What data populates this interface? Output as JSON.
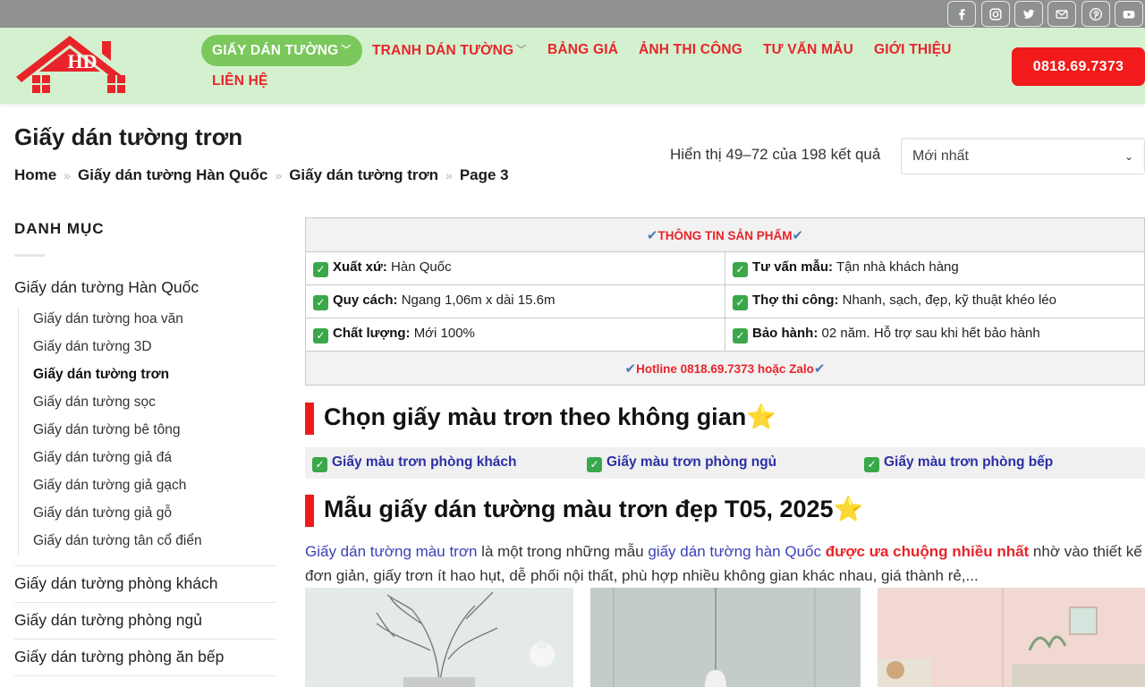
{
  "social_icons": [
    "facebook-icon",
    "instagram-icon",
    "twitter-icon",
    "email-icon",
    "pinterest-icon",
    "youtube-icon"
  ],
  "logo": {
    "text": "HD"
  },
  "nav": {
    "items": [
      {
        "label": "GIẤY DÁN TƯỜNG"
      },
      {
        "label": "TRANH DÁN TƯỜNG"
      },
      {
        "label": "BẢNG GIÁ"
      },
      {
        "label": "ẢNH THI CÔNG"
      },
      {
        "label": "TƯ VẤN MẪU"
      },
      {
        "label": "GIỚI THIỆU"
      },
      {
        "label": "LIÊN HỆ"
      }
    ],
    "hotline": "0818.69.7373"
  },
  "page": {
    "title": "Giấy dán tường trơn",
    "breadcrumb": [
      "Home",
      "Giấy dán tường Hàn Quốc",
      "Giấy dán tường trơn",
      "Page 3"
    ],
    "breadcrumb_sep": "»",
    "result_count": "Hiển thị 49–72 của 198 kết quả",
    "sort_selected": "Mới nhất"
  },
  "sidebar": {
    "heading": "DANH MỤC",
    "top_category": "Giấy dán tường Hàn Quốc",
    "sub_items": [
      "Giấy dán tường hoa văn",
      "Giấy dán tường 3D",
      "Giấy dán tường trơn",
      "Giấy dán tường sọc",
      "Giấy dán tường bê tông",
      "Giấy dán tường giả đá",
      "Giấy dán tường giả gạch",
      "Giấy dán tường giả gỗ",
      "Giấy dán tường tân cổ điển"
    ],
    "categories": [
      "Giấy dán tường phòng khách",
      "Giấy dán tường phòng ngủ",
      "Giấy dán tường phòng ăn bếp"
    ]
  },
  "info_table": {
    "header": "THÔNG TIN SẢN PHẨM",
    "rows": [
      [
        {
          "label": "Xuất xứ:",
          "value": "Hàn Quốc"
        },
        {
          "label": "Tư vấn mẫu:",
          "value": "Tận nhà khách hàng"
        }
      ],
      [
        {
          "label": "Quy cách:",
          "value": "Ngang 1,06m x dài 15.6m"
        },
        {
          "label": "Thợ thi công:",
          "value": "Nhanh, sạch, đẹp, kỹ thuật khéo léo"
        }
      ],
      [
        {
          "label": "Chất lượng:",
          "value": "Mới 100%"
        },
        {
          "label": "Bảo hành:",
          "value": "02 năm. Hỗ trợ sau khi hết bảo hành"
        }
      ]
    ],
    "footer": "Hotline 0818.69.7373 hoặc Zalo"
  },
  "section1": {
    "heading": "Chọn giấy màu trơn theo không gian",
    "links": [
      "Giấy màu trơn phòng khách",
      "Giấy màu trơn phòng ngủ",
      "Giấy màu trơn phòng bếp"
    ]
  },
  "section2": {
    "heading": "Mẫu giấy dán tường màu trơn đẹp T05, 2025",
    "para": {
      "link1": "Giấy dán tường màu trơn",
      "text1": " là một trong những mẫu ",
      "link2": "giấy dán tường hàn Quốc",
      "text2": " ",
      "highlight": "được ưa chuộng nhiều nhất",
      "text3": " nhờ vào thiết kế đơn giản, giấy trơn ít hao hụt, dễ phối nội thất, phù hợp nhiều không gian khác nhau, giá thành rẻ,..."
    }
  },
  "colors": {
    "header_bg": "#d4f1cf",
    "accent_red": "#e8242a",
    "active_green": "#7bc85c",
    "link_blue": "#2b2fa5"
  }
}
